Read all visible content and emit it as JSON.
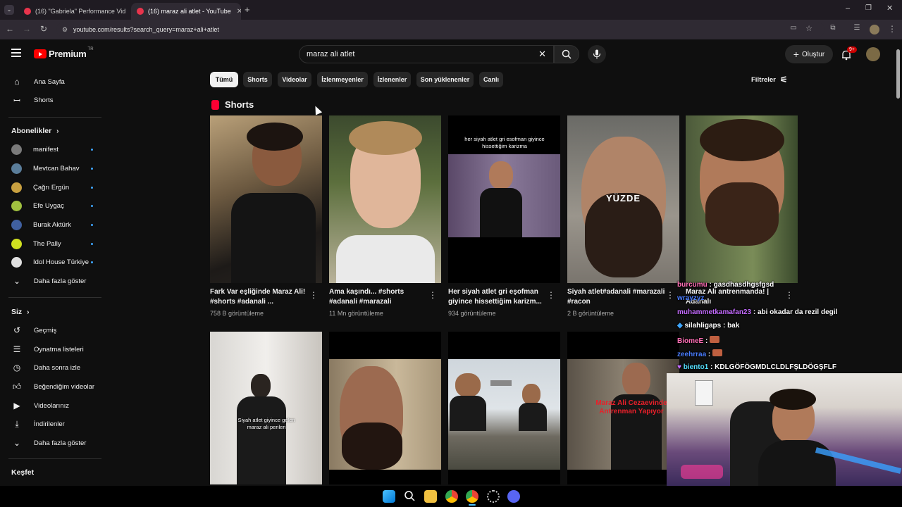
{
  "browser": {
    "tabs": [
      {
        "label": "(16) \"Gabriela\" Performance Vid"
      },
      {
        "label": "(16) maraz ali atlet - YouTube"
      }
    ],
    "url": "youtube.com/results?search_query=maraz+ali+atlet"
  },
  "header": {
    "logo": "Premium",
    "region": "TR",
    "search_value": "maraz ali atlet",
    "create_label": "Oluştur",
    "notifications": "9+"
  },
  "sidebar": {
    "home": "Ana Sayfa",
    "shorts": "Shorts",
    "subs_heading": "Abonelikler",
    "subs": [
      {
        "name": "manifest",
        "color": "#7a7a7a"
      },
      {
        "name": "Mevtcan Bahav",
        "color": "#5a7d9a"
      },
      {
        "name": "Çağrı Ergün",
        "color": "#c8a040"
      },
      {
        "name": "Efe Uygaç",
        "color": "#a0c040"
      },
      {
        "name": "Burak Aktürk",
        "color": "#4060a0"
      },
      {
        "name": "The Pally",
        "color": "#d0e020"
      },
      {
        "name": "Idol House Türkiye",
        "color": "#e0e0e0"
      }
    ],
    "show_more": "Daha fazla göster",
    "you_heading": "Siz",
    "you_items": [
      "Geçmiş",
      "Oynatma listeleri",
      "Daha sonra izle",
      "Beğendiğim videolar",
      "Videolarınız",
      "İndirilenler",
      "Daha fazla göster"
    ],
    "explore_heading": "Keşfet"
  },
  "chips": [
    "Tümü",
    "Shorts",
    "Videolar",
    "İzlenmeyenler",
    "İzlenenler",
    "Son yüklenenler",
    "Canlı"
  ],
  "filters_label": "Filtreler",
  "shorts_heading": "Shorts",
  "shorts": [
    {
      "title": "Fark Var eşliğinde Maraz Ali! #shorts #adanali ...",
      "views": "758 B görüntüleme"
    },
    {
      "title": "Ama kaşındı... #shorts #adanali #marazali",
      "views": "11 Mn görüntüleme"
    },
    {
      "title": "Her siyah atlet gri eşofman giyince hissettiğim karizm...",
      "views": "934 görüntüleme"
    },
    {
      "title": "Siyah atlet#adanali #marazali #racon",
      "views": "2 B görüntüleme"
    },
    {
      "title": "Maraz Ali antrenmanda! | Adanalı",
      "views": ""
    }
  ],
  "thumb_texts": {
    "t3": "her siyah atlet gri esofman giyince hissettiğim karizma",
    "t4": "YÜZDE",
    "r1": "Siyah atlet giyince gelen maraz ali perileri",
    "r4": "Maraz Ali Cezaevinde Antrenman Yapıyor"
  },
  "chat": [
    {
      "user": "burcumu",
      "msg": "gasdhasdhgsfgsd",
      "color": "#ff6fb5"
    },
    {
      "user": "wrayzyz",
      "msg": "",
      "color": "#4a7dff"
    },
    {
      "user": "muhammetkamafan23",
      "msg": "abi okadar da rezil degil",
      "color": "#c46bff"
    },
    {
      "user": "silahligaps",
      "msg": "bak",
      "color": "#ffffff"
    },
    {
      "user": "BiomeE",
      "msg": "",
      "color": "#ff6fb5"
    },
    {
      "user": "zeehrraa",
      "msg": "",
      "color": "#4a7dff"
    },
    {
      "user": "biento1",
      "msg": "KDLGÖFÖGMDLCLDLFŞLDÖGŞFLF",
      "color": "#55e0ff"
    }
  ]
}
